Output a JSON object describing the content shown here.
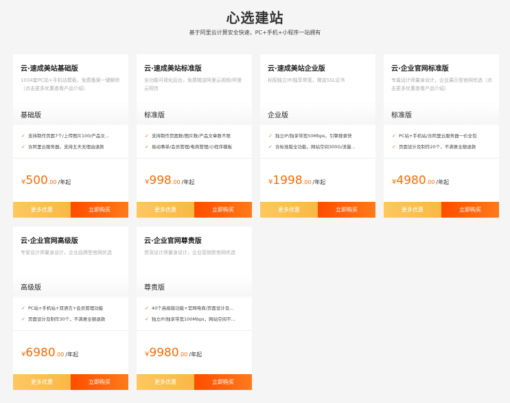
{
  "header": {
    "title": "心选建站",
    "subtitle": "基于阿里云计算安全快速，PC+手机+小程序一站拥有"
  },
  "labels": {
    "more_button": "更多优惠",
    "buy_button": "立即购买",
    "currency": "¥",
    "unit": "/年起"
  },
  "colors": {
    "accent": "#ff6a00",
    "more_button": "#fbc04f",
    "buy_button": "#ff5a0a"
  },
  "icons": {
    "feature_bullet": "check-icon"
  },
  "cards": [
    {
      "title": "云·速成美站基础版",
      "desc": "1034套PC站+手机站模板，免费备案一键解析（点击更多优惠查看产品介绍）",
      "tier": "基础版",
      "features": [
        "支持制作页面7个/上传图片100/产品文...",
        "含阿里云服务器，支持五天无理由退款"
      ],
      "price_int": "500",
      "price_dec": ".00"
    },
    {
      "title": "云·速成美站标准版",
      "desc": "全功能可视化后台，免费赠送阿里云视频/阿里云短信",
      "tier": "标准版",
      "features": [
        "支持制作页面数/图片数/产品文章数不限",
        "易动事单/会员管理/电商管理/小程序模板"
      ],
      "price_int": "998",
      "price_dec": ".00"
    },
    {
      "title": "云·速成美站企业版",
      "desc": "标配独立IP/独享带宽，赠送SSL证书",
      "tier": "企业版",
      "features": [
        "独立IP/独享带宽50Mbps，引擎搜录快",
        "含标准版全功能，网站空间300G/流量..."
      ],
      "price_int": "1998",
      "price_dec": ".00"
    },
    {
      "title": "云·企业官网标准版",
      "desc": "专属设计师量身设计，企业展示型官网优选（点击更多优惠查看产品介绍）",
      "tier": "标准版",
      "features": [
        "PC站+手机站/含阿里云服务器一价全包",
        "页面设计及制作20个，不满意全额退款"
      ],
      "price_int": "4980",
      "price_dec": ".00"
    },
    {
      "title": "云·企业官网高级版",
      "desc": "专家设计师量身设计，企业品牌型官网优选",
      "tier": "高级版",
      "features": [
        "PC站+手机站+双语言+会员管理功能",
        "页面设计及制作30个，不满意全额退款"
      ],
      "price_int": "6980",
      "price_dec": ".00"
    },
    {
      "title": "云·企业官网尊贵版",
      "desc": "资深设计师量身设计，企业营销型官网优选",
      "tier": "尊贵版",
      "features": [
        "40个高级版功能+官网电商/页面设计及...",
        "独立IP/独享带宽100Mbps，网站空间不..."
      ],
      "price_int": "9980",
      "price_dec": ".00"
    }
  ]
}
